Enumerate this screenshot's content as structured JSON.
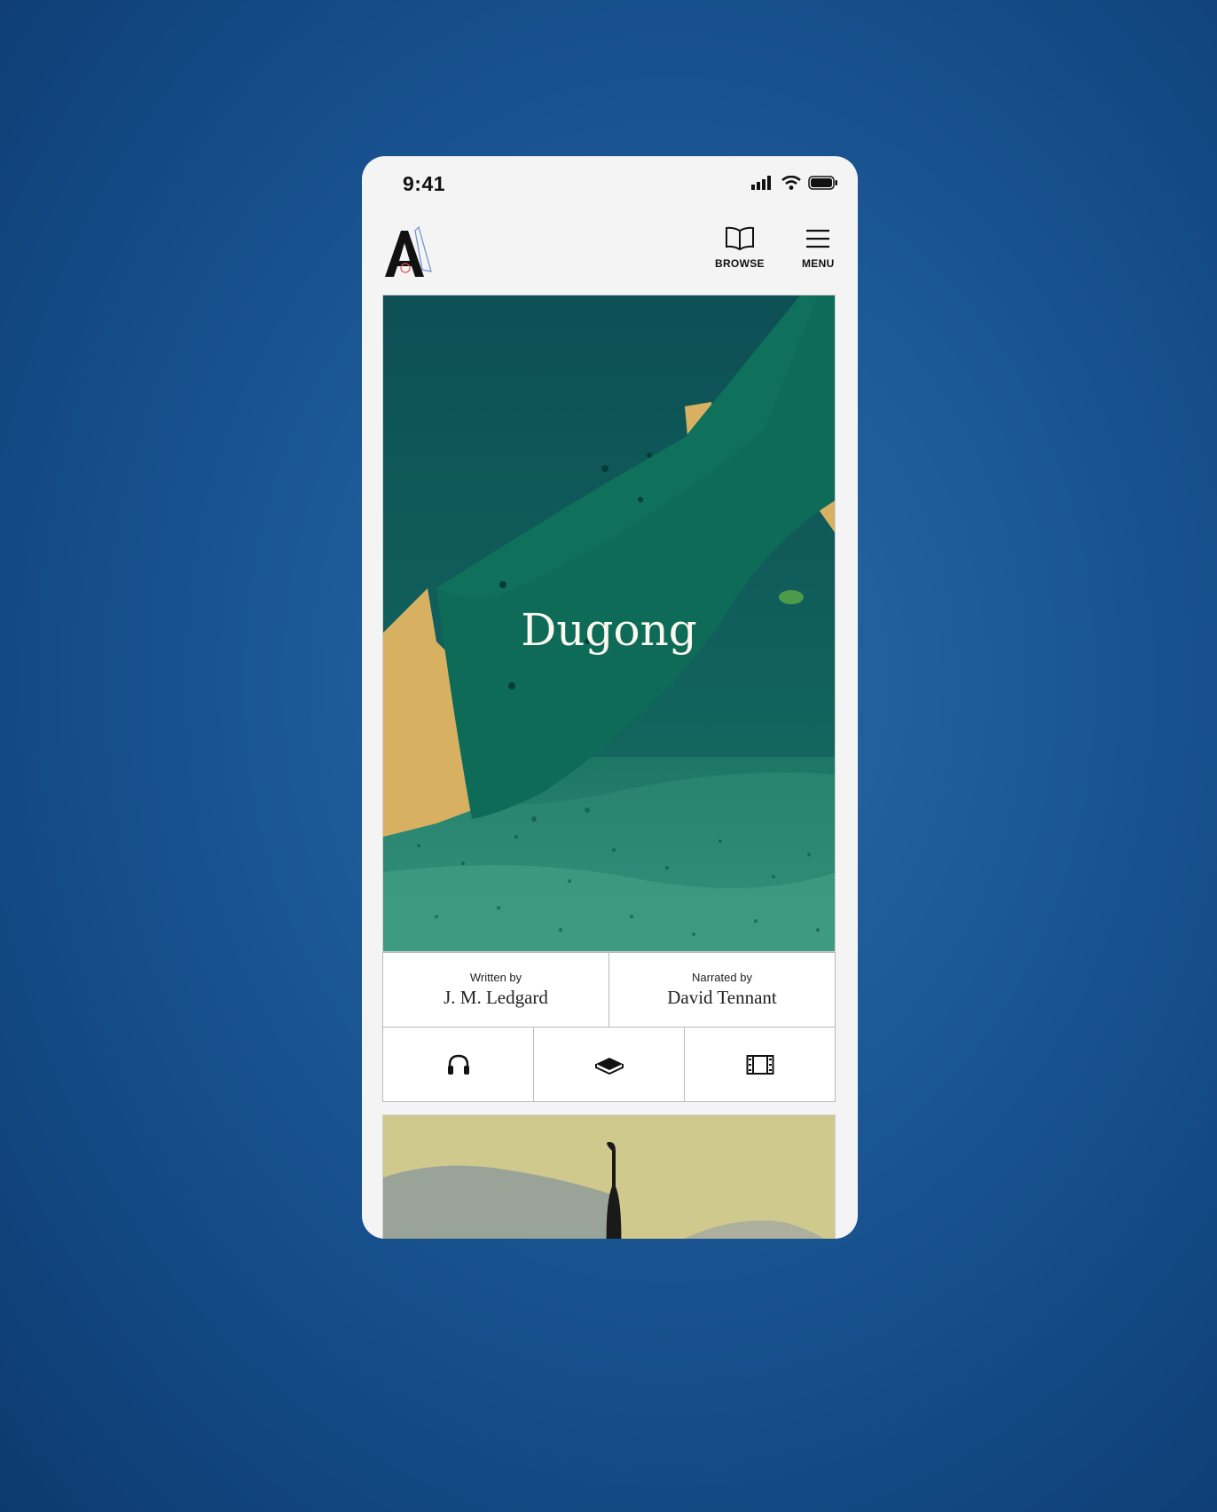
{
  "status_bar": {
    "time": "9:41"
  },
  "nav": {
    "browse_label": "BROWSE",
    "menu_label": "MENU"
  },
  "book": {
    "title": "Dugong",
    "written_by_label": "Written by",
    "author": "J. M. Ledgard",
    "narrated_by_label": "Narrated by",
    "narrator": "David Tennant"
  },
  "formats": [
    {
      "icon": "headphones-icon"
    },
    {
      "icon": "book-icon"
    },
    {
      "icon": "film-icon"
    }
  ],
  "colors": {
    "background": "#1d5a97",
    "cover_green": "#0f6a5a",
    "cover_sand": "#d8b062",
    "app_bg": "#f4f4f4"
  }
}
